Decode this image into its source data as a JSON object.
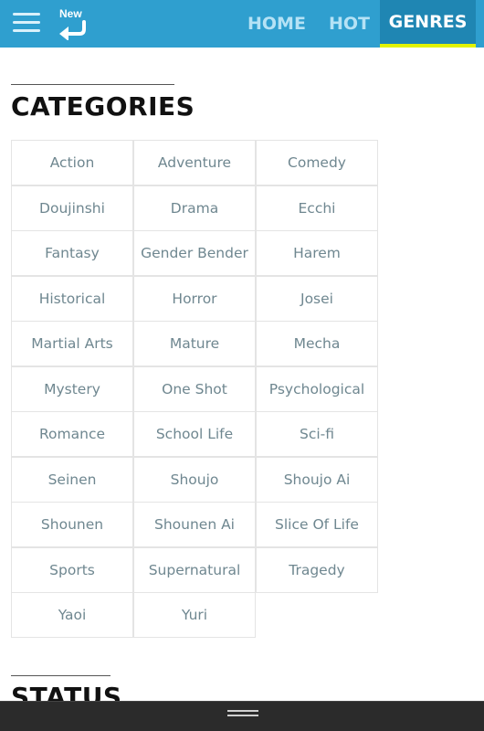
{
  "header": {
    "new_label": "New",
    "nav": {
      "home": "HOME",
      "hot": "HOT",
      "genres": "GENRES"
    },
    "active_tab": "GENRES",
    "colors": {
      "bar": "#2f9fcf",
      "active_tab_bg": "#1f86b3",
      "active_underline": "#e2f300"
    }
  },
  "categories": {
    "title": "CATEGORIES",
    "items": [
      "Action",
      "Adventure",
      "Comedy",
      "Doujinshi",
      "Drama",
      "Ecchi",
      "Fantasy",
      "Gender Bender",
      "Harem",
      "Historical",
      "Horror",
      "Josei",
      "Martial Arts",
      "Mature",
      "Mecha",
      "Mystery",
      "One Shot",
      "Psychological",
      "Romance",
      "School Life",
      "Sci-fi",
      "Seinen",
      "Shoujo",
      "Shoujo Ai",
      "Shounen",
      "Shounen Ai",
      "Slice Of Life",
      "Sports",
      "Supernatural",
      "Tragedy",
      "Yaoi",
      "Yuri"
    ]
  },
  "status": {
    "title": "STATUS"
  },
  "icons": {
    "menu": "hamburger-menu-icon",
    "new": "back-arrow-icon",
    "handle": "drag-handle-icon"
  }
}
